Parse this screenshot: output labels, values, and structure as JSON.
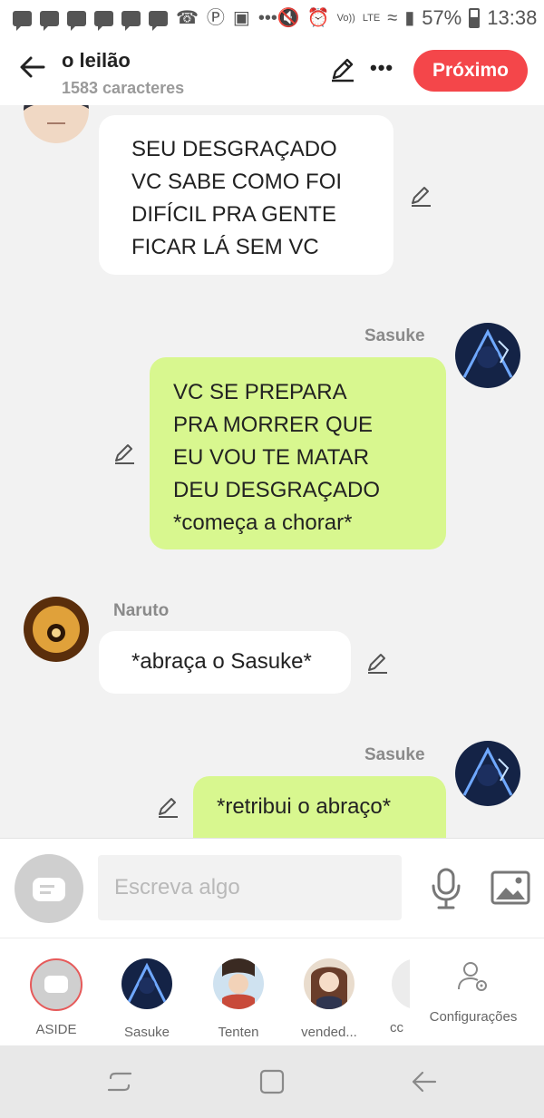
{
  "status_bar": {
    "battery": "57%",
    "time": "13:38",
    "network": "LTE",
    "volte": "Vo))",
    "dots": "•••"
  },
  "header": {
    "title": "o leilão",
    "subtitle": "1583 caracteres",
    "next_button": "Próximo"
  },
  "messages": [
    {
      "side": "left",
      "sender": "",
      "lines": [
        "SEU DESGRAÇADO",
        "VC SABE COMO FOI",
        "DIFÍCIL PRA GENTE",
        "FICAR LÁ SEM VC"
      ]
    },
    {
      "side": "right",
      "sender": "Sasuke",
      "lines": [
        "VC SE PREPARA",
        "PRA MORRER QUE",
        "EU VOU TE MATAR",
        "DEU DESGRAÇADO",
        "*começa a chorar*"
      ]
    },
    {
      "side": "left",
      "sender": "Naruto",
      "lines": [
        "*abraça o Sasuke*"
      ]
    },
    {
      "side": "right",
      "sender": "Sasuke",
      "lines": [
        "*retribui o abraço*"
      ]
    }
  ],
  "input": {
    "placeholder": "Escreva algo"
  },
  "characters": [
    {
      "label": "ASIDE"
    },
    {
      "label": "Sasuke"
    },
    {
      "label": "Tenten"
    },
    {
      "label": "vended..."
    },
    {
      "label": "cc"
    }
  ],
  "settings_label": "Configurações",
  "colors": {
    "accent": "#f4464a",
    "my_bubble": "#d8f78f",
    "other_bubble": "#ffffff",
    "background": "#f2f2f2"
  },
  "icons": [
    "back-arrow-icon",
    "pencil-icon",
    "more-icon",
    "mic-icon",
    "image-icon",
    "settings-icon",
    "recent-apps-icon",
    "home-icon",
    "back-icon"
  ]
}
